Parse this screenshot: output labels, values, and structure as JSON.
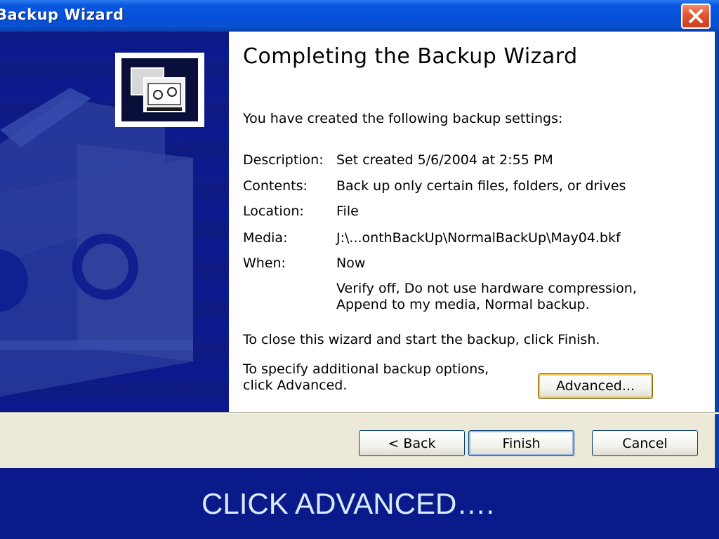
{
  "window": {
    "title": "Backup Wizard",
    "close_icon": "close-icon"
  },
  "wizard": {
    "heading": "Completing the Backup Wizard",
    "intro": "You have created the following backup settings:",
    "settings": [
      {
        "label": "Description:",
        "value": "Set created 5/6/2004 at 2:55 PM"
      },
      {
        "label": "Contents:",
        "value": "Back up only certain files, folders, or drives"
      },
      {
        "label": "Location:",
        "value": "File"
      },
      {
        "label": "Media:",
        "value": "J:\\...onthBackUp\\NormalBackUp\\May04.bkf"
      },
      {
        "label": "When:",
        "value": "Now"
      }
    ],
    "options_line1": "Verify off, Do not use hardware compression,",
    "options_line2": "Append to my media, Normal backup.",
    "close_hint": "To close this wizard and start the backup, click Finish.",
    "advanced_hint_line1": "To specify additional backup options,",
    "advanced_hint_line2": "click Advanced.",
    "advanced_button": "Advanced..."
  },
  "buttons": {
    "back": "< Back",
    "finish": "Finish",
    "cancel": "Cancel"
  },
  "caption": "CLICK ADVANCED….",
  "colors": {
    "titlebar": "#0550d8",
    "side_panel": "#0d1b8e",
    "button_strip": "#ece9d8",
    "caption_background": "#0b1a8a",
    "caption_text": "#d8ecff",
    "close_button": "#e2542f"
  }
}
